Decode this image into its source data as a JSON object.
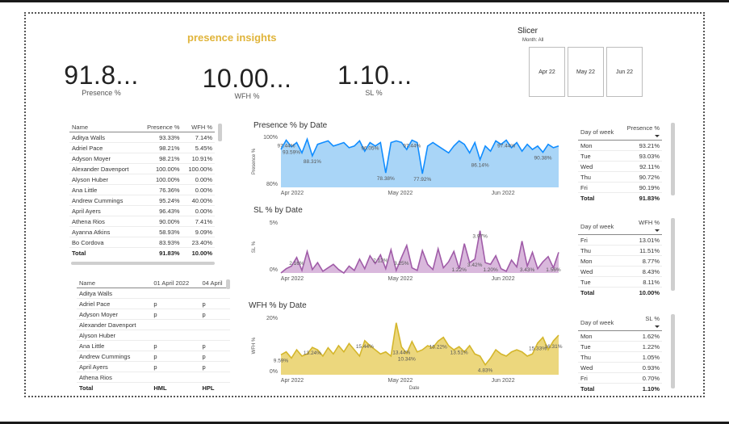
{
  "title": "presence insights",
  "kpis": [
    {
      "value": "91.8...",
      "label": "Presence %"
    },
    {
      "value": "10.00...",
      "label": "WFH %"
    },
    {
      "value": "1.10...",
      "label": "SL %"
    }
  ],
  "slicer": {
    "title": "Slicer",
    "subtitle": "Month: All",
    "options": [
      "Apr 22",
      "May 22",
      "Jun 22"
    ]
  },
  "employee_table": {
    "headers": [
      "Name",
      "Presence %",
      "WFH %"
    ],
    "rows": [
      [
        "Aditya Walls",
        "93.33%",
        "7.14%"
      ],
      [
        "Adriel Pace",
        "98.21%",
        "5.45%"
      ],
      [
        "Adyson Moyer",
        "98.21%",
        "10.91%"
      ],
      [
        "Alexander Davenport",
        "100.00%",
        "100.00%"
      ],
      [
        "Alyson Huber",
        "100.00%",
        "0.00%"
      ],
      [
        "Ana Little",
        "76.36%",
        "0.00%"
      ],
      [
        "Andrew Cummings",
        "95.24%",
        "40.00%"
      ],
      [
        "April Ayers",
        "96.43%",
        "0.00%"
      ],
      [
        "Athena Rios",
        "90.00%",
        "7.41%"
      ],
      [
        "Ayanna Atkins",
        "58.93%",
        "9.09%"
      ],
      [
        "Bo Cordova",
        "83.93%",
        "23.40%"
      ]
    ],
    "total": [
      "Total",
      "91.83%",
      "10.00%"
    ]
  },
  "matrix_table": {
    "headers": [
      "Name",
      "01 April 2022",
      "04 April"
    ],
    "rows": [
      [
        "Aditya Walls",
        "",
        ""
      ],
      [
        "Adriel Pace",
        "p",
        "p"
      ],
      [
        "Adyson Moyer",
        "p",
        "p"
      ],
      [
        "Alexander Davenport",
        "",
        ""
      ],
      [
        "Alyson Huber",
        "",
        ""
      ],
      [
        "Ana Little",
        "p",
        "p"
      ],
      [
        "Andrew Cummings",
        "p",
        "p"
      ],
      [
        "April Ayers",
        "p",
        "p"
      ],
      [
        "Athena Rios",
        "",
        ""
      ]
    ],
    "total": [
      "Total",
      "HML",
      "HPL"
    ]
  },
  "dow_presence": {
    "headers": [
      "Day of week",
      "Presence %"
    ],
    "rows": [
      [
        "Mon",
        "93.21%"
      ],
      [
        "Tue",
        "93.03%"
      ],
      [
        "Wed",
        "92.11%"
      ],
      [
        "Thu",
        "90.72%"
      ],
      [
        "Fri",
        "90.19%"
      ]
    ],
    "total": [
      "Total",
      "91.83%"
    ]
  },
  "dow_wfh": {
    "headers": [
      "Day of week",
      "WFH %"
    ],
    "rows": [
      [
        "Fri",
        "13.01%"
      ],
      [
        "Thu",
        "11.51%"
      ],
      [
        "Mon",
        "8.77%"
      ],
      [
        "Wed",
        "8.43%"
      ],
      [
        "Tue",
        "8.11%"
      ]
    ],
    "total": [
      "Total",
      "10.00%"
    ]
  },
  "dow_sl": {
    "headers": [
      "Day of week",
      "SL %"
    ],
    "rows": [
      [
        "Mon",
        "1.62%"
      ],
      [
        "Tue",
        "1.22%"
      ],
      [
        "Thu",
        "1.05%"
      ],
      [
        "Wed",
        "0.93%"
      ],
      [
        "Fri",
        "0.70%"
      ]
    ],
    "total": [
      "Total",
      "1.10%"
    ]
  },
  "chart_data": [
    {
      "type": "area",
      "title": "Presence % by Date",
      "ylabel": "Presence %",
      "xlabel": "",
      "x_ticks": [
        "Apr 2022",
        "May 2022",
        "Jun 2022"
      ],
      "y_ticks": [
        "100%",
        "80%"
      ],
      "ylim": [
        70,
        100
      ],
      "color": "#118dff",
      "fill": "#a9d5f7",
      "values": [
        92,
        97.4,
        93.6,
        96,
        90,
        98,
        88.3,
        95,
        96,
        97,
        94,
        95,
        96,
        93,
        94,
        97,
        91,
        96,
        94,
        96,
        78.4,
        96,
        97,
        96.1,
        92,
        97.4,
        96,
        77.9,
        94,
        96,
        94,
        92,
        90,
        94,
        97,
        95,
        90,
        96,
        86.1,
        94,
        91,
        97,
        95,
        97.4,
        93,
        96,
        91,
        95,
        92,
        94,
        90.4,
        95,
        93,
        94
      ],
      "labels": [
        {
          "i": 1,
          "text": "97.44%"
        },
        {
          "i": 2,
          "text": "93.59%"
        },
        {
          "i": 6,
          "text": "88.31%"
        },
        {
          "i": 17,
          "text": "96.05%"
        },
        {
          "i": 20,
          "text": "78.38%"
        },
        {
          "i": 25,
          "text": "97.44%"
        },
        {
          "i": 27,
          "text": "77.92%"
        },
        {
          "i": 38,
          "text": "86.14%"
        },
        {
          "i": 43,
          "text": "97.44%"
        },
        {
          "i": 50,
          "text": "90.38%"
        }
      ]
    },
    {
      "type": "area",
      "title": "SL % by Date",
      "ylabel": "SL %",
      "xlabel": "",
      "x_ticks": [
        "Apr 2022",
        "May 2022",
        "Jun 2022"
      ],
      "y_ticks": [
        "5%",
        "0%"
      ],
      "ylim": [
        0,
        6
      ],
      "color": "#a05ca8",
      "fill": "#d9b8dc",
      "values": [
        0,
        0.5,
        0.8,
        1.8,
        0.3,
        2.5,
        0.4,
        1.2,
        0.2,
        0.6,
        1.0,
        0.4,
        0,
        0.8,
        0.3,
        1.6,
        0.5,
        2.0,
        1.1,
        2.1,
        0.5,
        2.7,
        0.3,
        1.8,
        3.2,
        0.6,
        0.3,
        2.6,
        1.0,
        0.4,
        2.8,
        0.6,
        1.3,
        2.5,
        0.5,
        3.4,
        1.2,
        1.6,
        4.9,
        1.2,
        1.0,
        2.0,
        0.5,
        0.2,
        1.5,
        0.7,
        3.7,
        0.8,
        2.4,
        0.5,
        1.3,
        1.9,
        0.6,
        2.4
      ],
      "labels": [
        {
          "i": 3,
          "text": "2.16%"
        },
        {
          "i": 19,
          "text": "2.12%"
        },
        {
          "i": 23,
          "text": "3.25%"
        },
        {
          "i": 34,
          "text": "1.22%"
        },
        {
          "i": 37,
          "text": "3.42%"
        },
        {
          "i": 38,
          "text": "3.97%"
        },
        {
          "i": 40,
          "text": "1.20%"
        },
        {
          "i": 47,
          "text": "3.43%"
        },
        {
          "i": 52,
          "text": "1.56%"
        }
      ]
    },
    {
      "type": "area",
      "title": "WFH % by Date",
      "ylabel": "WFH %",
      "xlabel": "Date",
      "x_ticks": [
        "Apr 2022",
        "May 2022",
        "Jun 2022"
      ],
      "y_ticks": [
        "20%",
        "0%"
      ],
      "ylim": [
        0,
        28
      ],
      "color": "#d4b62c",
      "fill": "#ecd77d",
      "values": [
        9.6,
        11,
        8,
        12,
        9,
        10,
        13.2,
        12,
        9,
        13,
        10,
        14,
        11,
        15,
        12,
        9,
        16.4,
        14,
        12,
        10,
        11,
        9,
        25,
        13.4,
        10.3,
        16,
        11,
        12,
        14,
        13,
        16.2,
        18,
        14,
        12,
        13.5,
        11,
        14,
        10,
        9,
        4.8,
        8,
        12,
        10,
        9,
        11,
        12,
        11,
        9,
        10,
        15.3,
        18,
        12,
        16.3,
        19
      ],
      "labels": [
        {
          "i": 0,
          "text": "9.59%"
        },
        {
          "i": 6,
          "text": "13.24%"
        },
        {
          "i": 16,
          "text": "15.44%"
        },
        {
          "i": 23,
          "text": "13.44%"
        },
        {
          "i": 24,
          "text": "10.34%"
        },
        {
          "i": 30,
          "text": "16.22%"
        },
        {
          "i": 34,
          "text": "13.51%"
        },
        {
          "i": 39,
          "text": "4.83%"
        },
        {
          "i": 49,
          "text": "15.33%"
        },
        {
          "i": 52,
          "text": "16.31%"
        }
      ]
    }
  ]
}
